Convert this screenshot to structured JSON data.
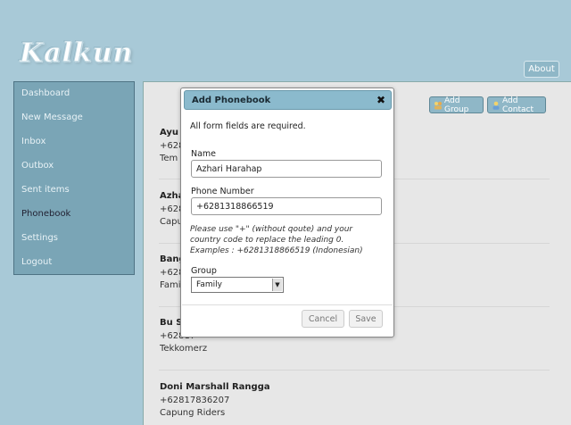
{
  "app": {
    "logo": "Kalkun",
    "about_label": "About"
  },
  "sidebar": {
    "items": [
      {
        "label": "Dashboard"
      },
      {
        "label": "New Message"
      },
      {
        "label": "Inbox"
      },
      {
        "label": "Outbox"
      },
      {
        "label": "Sent items"
      },
      {
        "label": "Phonebook",
        "active": true
      },
      {
        "label": "Settings"
      },
      {
        "label": "Logout"
      }
    ]
  },
  "toolbar": {
    "add_group": "Add Group",
    "add_contact": "Add Contact"
  },
  "contacts": [
    {
      "name": "Ayu",
      "phone": "+628",
      "group": "Tem"
    },
    {
      "name": "Azha",
      "phone": "+628",
      "group": "Capu"
    },
    {
      "name": "Bang",
      "phone": "+628",
      "group": "Fami"
    },
    {
      "name": "Bu S",
      "phone": "+62817",
      "group": "Tekkomerz"
    },
    {
      "name": "Doni Marshall Rangga",
      "phone": "+62817836207",
      "group": "Capung Riders"
    }
  ],
  "modal": {
    "title": "Add Phonebook",
    "close": "✖",
    "required_note": "All form fields are required.",
    "name_label": "Name",
    "name_value": "Azhari Harahap",
    "phone_label": "Phone Number",
    "phone_value": "+6281318866519",
    "hint_line1": "Please use \"+\" (without qoute) and your",
    "hint_line2": "country code to replace the leading 0.",
    "hint_line3": "Examples : +6281318866519 (Indonesian)",
    "group_label": "Group",
    "group_value": "Family",
    "cancel_label": "Cancel",
    "save_label": "Save"
  }
}
